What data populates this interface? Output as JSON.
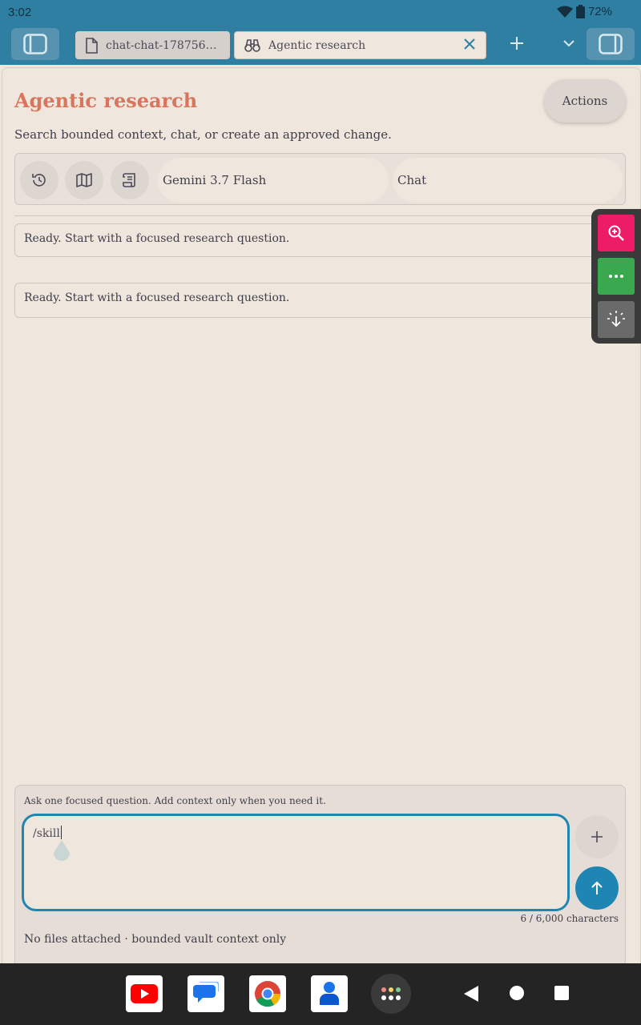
{
  "status": {
    "time": "3:02",
    "battery": "72%"
  },
  "tabs": [
    {
      "label": "chat-chat-178756105...",
      "icon": "file-icon"
    },
    {
      "label": "Agentic research",
      "icon": "binoculars-icon"
    }
  ],
  "header": {
    "title": "Agentic research",
    "subtitle": "Search bounded context, chat, or create an approved change.",
    "actions_label": "Actions"
  },
  "toolbar": {
    "buttons": [
      "history-icon",
      "map-icon",
      "scroll-icon"
    ],
    "model": "Gemini 3.7 Flash",
    "mode": "Chat"
  },
  "messages": [
    "Ready. Start with a focused research question.",
    "Ready. Start with a focused research question."
  ],
  "composer": {
    "hint": "Ask one focused question. Add context only when you need it.",
    "value": "/skill",
    "counter": "6 / 6,000 characters",
    "files": "No files attached · bounded vault context only"
  },
  "floating_tools": [
    "zoom-in-icon",
    "more-icon",
    "tap-icon"
  ],
  "dock_apps": [
    "YouTube",
    "Messages",
    "Chrome",
    "Contacts"
  ],
  "colors": {
    "accent": "#2f7fa3",
    "title": "#d9745d",
    "send": "#1f86b3",
    "background": "#efe6dd"
  }
}
